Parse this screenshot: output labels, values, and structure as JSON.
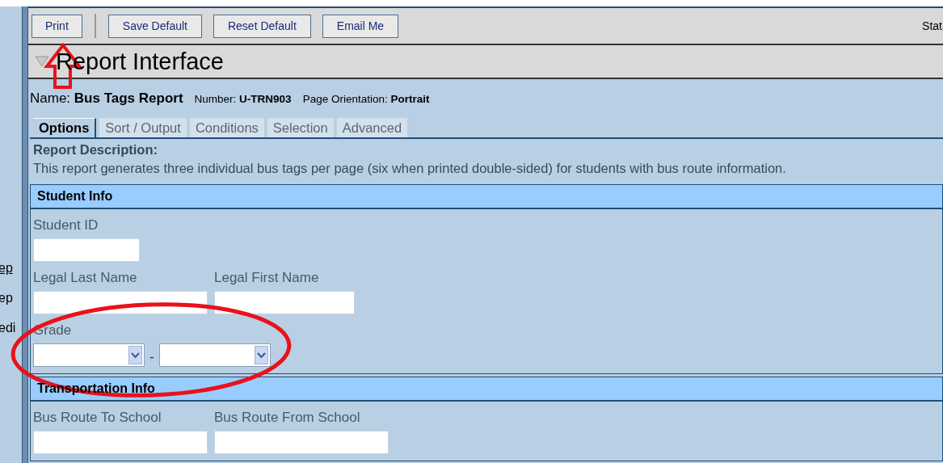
{
  "sidebar": {
    "items": [
      {
        "label": "ep",
        "underlined": true
      },
      {
        "label": "ep",
        "underlined": false
      },
      {
        "label": "edi",
        "underlined": false
      }
    ]
  },
  "toolbar": {
    "buttons": [
      "Print",
      "Save Default",
      "Reset Default",
      "Email Me"
    ],
    "status": "Stat"
  },
  "title": "Report Interface",
  "report": {
    "name_label": "Name:",
    "name": "Bus Tags Report",
    "number_label": "Number:",
    "number": "U-TRN903",
    "orientation_label": "Page Orientation:",
    "orientation": "Portrait"
  },
  "tabs": [
    {
      "label": "Options",
      "selected": true
    },
    {
      "label": "Sort / Output",
      "selected": false
    },
    {
      "label": "Conditions",
      "selected": false
    },
    {
      "label": "Selection",
      "selected": false
    },
    {
      "label": "Advanced",
      "selected": false
    }
  ],
  "description": {
    "heading": "Report Description:",
    "text": "This report generates three individual bus tags per page (six when printed double-sided) for students with bus route information."
  },
  "sections": [
    {
      "title": "Student Info",
      "rows": [
        [
          {
            "kind": "short",
            "label": "Student ID"
          }
        ],
        [
          {
            "kind": "long",
            "label": "Legal Last Name"
          },
          {
            "kind": "medium",
            "label": "Legal First Name"
          }
        ],
        [
          {
            "kind": "range",
            "label": "Grade",
            "separator": "-"
          }
        ]
      ]
    },
    {
      "title": "Transportation Info",
      "rows": [
        [
          {
            "kind": "long",
            "label": "Bus Route To School"
          },
          {
            "kind": "long",
            "label": "Bus Route From School"
          }
        ]
      ]
    }
  ]
}
